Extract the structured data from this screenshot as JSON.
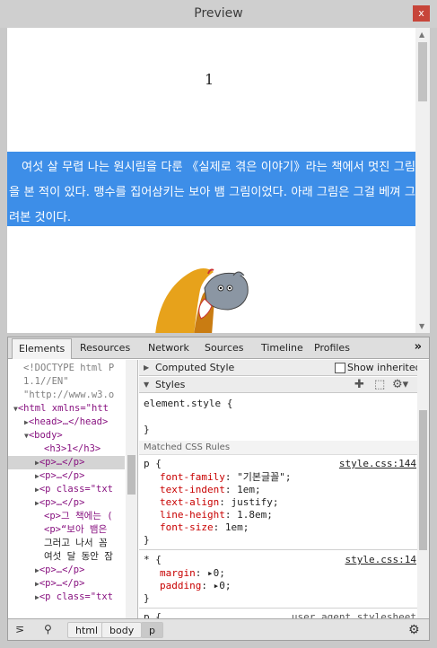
{
  "window": {
    "title": "Preview",
    "close": "x"
  },
  "preview": {
    "heading": "1",
    "paragraph": "여섯 살 무렵 나는 원시림을 다룬 《실제로 겪은 이야기》라는 책에서 멋진 그림을 본 적이 있다. 맹수를 집어삼키는 보아 뱀 그림이었다. 아래 그림은 그걸 베껴 그려본 것이다."
  },
  "devtools": {
    "tabs": [
      "Elements",
      "Resources",
      "Network",
      "Sources",
      "Timeline",
      "Profiles"
    ],
    "more": "»",
    "dom": [
      {
        "t": "<!DOCTYPE html P"
      },
      {
        "t": "1.1//EN\""
      },
      {
        "t": "\"http://www.w3.o"
      },
      {
        "t": "<html xmlns=\"htt"
      },
      {
        "t": "<head>…</head>"
      },
      {
        "t": "<body>"
      },
      {
        "t": "<h3>1</h3>"
      },
      {
        "t": "<p>…</p>"
      },
      {
        "t": "<p>…</p>"
      },
      {
        "t": "<p class=\"txt"
      },
      {
        "t": "<p>…</p>"
      },
      {
        "t": "<p>그 책에는 ( "
      },
      {
        "t": "<p>“보아 뱀은 "
      },
      {
        "t": "그러고 나서 꼼"
      },
      {
        "t": "여섯 달 동안 잠"
      },
      {
        "t": "<p>…</p>"
      },
      {
        "t": "<p>…</p>"
      },
      {
        "t": "<p class=\"txt"
      }
    ],
    "computed_style": "Computed Style",
    "show_inherited": "Show inherited",
    "styles": "Styles",
    "element_style": "element.style {",
    "close_brace": "}",
    "matched_rules": "Matched CSS Rules",
    "rule1": {
      "selector": "p {",
      "source": "style.css:144",
      "props": [
        {
          "n": "font-family",
          "v": "\"기본글꼴\";"
        },
        {
          "n": "text-indent",
          "v": "1em;"
        },
        {
          "n": "text-align",
          "v": "justify;"
        },
        {
          "n": "line-height",
          "v": "1.8em;"
        },
        {
          "n": "font-size",
          "v": "1em;"
        }
      ]
    },
    "rule2": {
      "selector": "* {",
      "source": "style.css:14",
      "props": [
        {
          "n": "margin",
          "v": "▸0;"
        },
        {
          "n": "padding",
          "v": "▸0;"
        }
      ]
    },
    "rule3": {
      "selector": "p {",
      "source": "user agent stylesheet"
    },
    "breadcrumbs": [
      "html",
      "body",
      "p"
    ]
  }
}
